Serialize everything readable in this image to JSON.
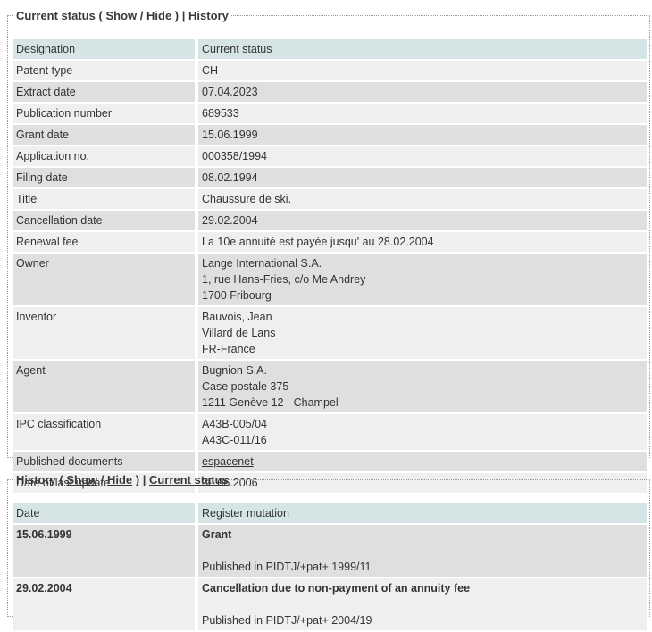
{
  "current": {
    "legend": {
      "title": "Current status",
      "open": "(",
      "show": "Show",
      "sep": "/",
      "hide": "Hide",
      "close": ")",
      "bar": "|",
      "history_link": "History"
    },
    "header": {
      "col1": "Designation",
      "col2": "Current status"
    },
    "rows": {
      "patent_type": {
        "label": "Patent type",
        "value": "CH"
      },
      "extract_date": {
        "label": "Extract date",
        "value": "07.04.2023"
      },
      "publication_number": {
        "label": "Publication number",
        "value": "689533"
      },
      "grant_date": {
        "label": "Grant date",
        "value": "15.06.1999"
      },
      "application_no": {
        "label": "Application no.",
        "value": "000358/1994"
      },
      "filing_date": {
        "label": "Filing date",
        "value": "08.02.1994"
      },
      "title": {
        "label": "Title",
        "value": "Chaussure de ski."
      },
      "cancellation_date": {
        "label": "Cancellation date",
        "value": "29.02.2004"
      },
      "renewal_fee": {
        "label": "Renewal fee",
        "value": "La 10e annuité est payée jusqu' au 28.02.2004"
      },
      "owner": {
        "label": "Owner",
        "lines": [
          "Lange International S.A.",
          "1, rue Hans-Fries, c/o Me Andrey",
          "1700 Fribourg"
        ]
      },
      "inventor": {
        "label": "Inventor",
        "lines": [
          "Bauvois, Jean",
          "Villard de Lans",
          "FR-France"
        ]
      },
      "agent": {
        "label": "Agent",
        "lines": [
          "Bugnion S.A.",
          "Case postale 375",
          "1211 Genève 12 - Champel"
        ]
      },
      "ipc": {
        "label": "IPC classification",
        "lines": [
          "A43B-005/04",
          "A43C-011/16"
        ]
      },
      "published_docs": {
        "label": "Published documents",
        "link": "espacenet"
      },
      "last_update": {
        "label": "Date of last update",
        "value": "30.06.2006"
      }
    }
  },
  "history": {
    "legend": {
      "title": "History",
      "open": "(",
      "show": "Show",
      "sep": "/",
      "hide": "Hide",
      "close": ")",
      "bar": "|",
      "current_link": "Current status"
    },
    "header": {
      "col1": "Date",
      "col2": "Register mutation"
    },
    "entries": [
      {
        "date": "15.06.1999",
        "mutation": "Grant",
        "published": "Published in PIDTJ/+pat+ 1999/11"
      },
      {
        "date": "29.02.2004",
        "mutation": "Cancellation due to non-payment of an annuity fee",
        "published": "Published in PIDTJ/+pat+ 2004/19"
      }
    ]
  }
}
